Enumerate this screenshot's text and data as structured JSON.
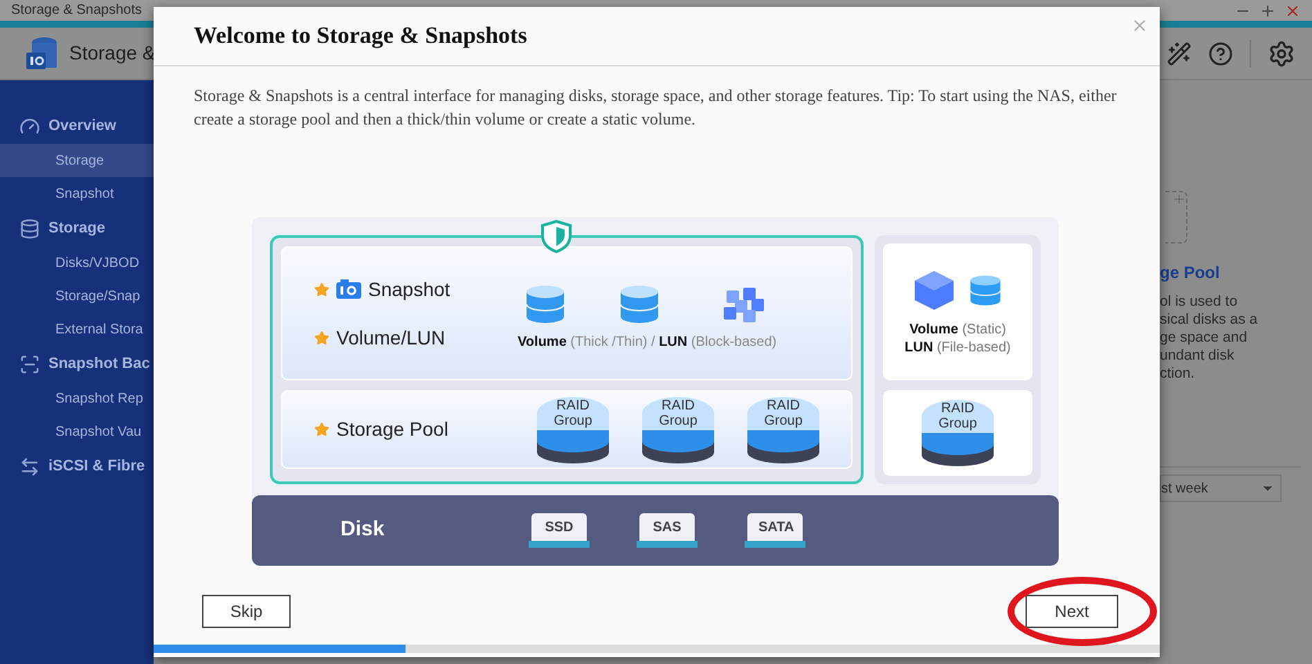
{
  "window": {
    "title": "Storage & Snapshots"
  },
  "app_header": {
    "title": "Storage &"
  },
  "sidebar": {
    "groups": [
      {
        "label": "Overview",
        "items": [
          {
            "label": "Storage",
            "selected": true
          },
          {
            "label": "Snapshot",
            "selected": false
          }
        ]
      },
      {
        "label": "Storage",
        "items": [
          {
            "label": "Disks/VJBOD",
            "selected": false
          },
          {
            "label": "Storage/Snap",
            "selected": false
          },
          {
            "label": "External Stora",
            "selected": false
          }
        ]
      },
      {
        "label": "Snapshot Bac",
        "items": [
          {
            "label": "Snapshot Rep",
            "selected": false
          },
          {
            "label": "Snapshot Vau",
            "selected": false
          }
        ]
      },
      {
        "label": "iSCSI & Fibre"
      }
    ]
  },
  "background_panel": {
    "title": "ge Pool",
    "description_lines": [
      "ol is used to",
      "sical disks as a",
      "ge space and",
      "undant disk",
      "ction."
    ],
    "dropdown": {
      "value": "st week"
    }
  },
  "dialog": {
    "title": "Welcome to Storage & Snapshots",
    "description": "Storage & Snapshots is a central interface for managing disks, storage space, and other storage features. Tip: To start using the NAS, either create a storage pool and then a thick/thin volume or create a static volume.",
    "diagram": {
      "snapshot_label": "Snapshot",
      "volume_label": "Volume/LUN",
      "volume_caption": "**Volume** (Thick /Thin)  / **LUN** (Block-based)",
      "pool_label": "Storage Pool",
      "raid_groups": [
        "RAID Group",
        "RAID Group",
        "RAID Group"
      ],
      "static_captions": [
        "**Volume** (Static)",
        "**LUN** (File-based)"
      ],
      "static_raid_group": "RAID Group",
      "disk_label": "Disk",
      "disk_types": [
        "SSD",
        "SAS",
        "SATA"
      ]
    },
    "buttons": {
      "skip": "Skip",
      "next": "Next"
    },
    "progress": {
      "level": 0.25
    }
  }
}
